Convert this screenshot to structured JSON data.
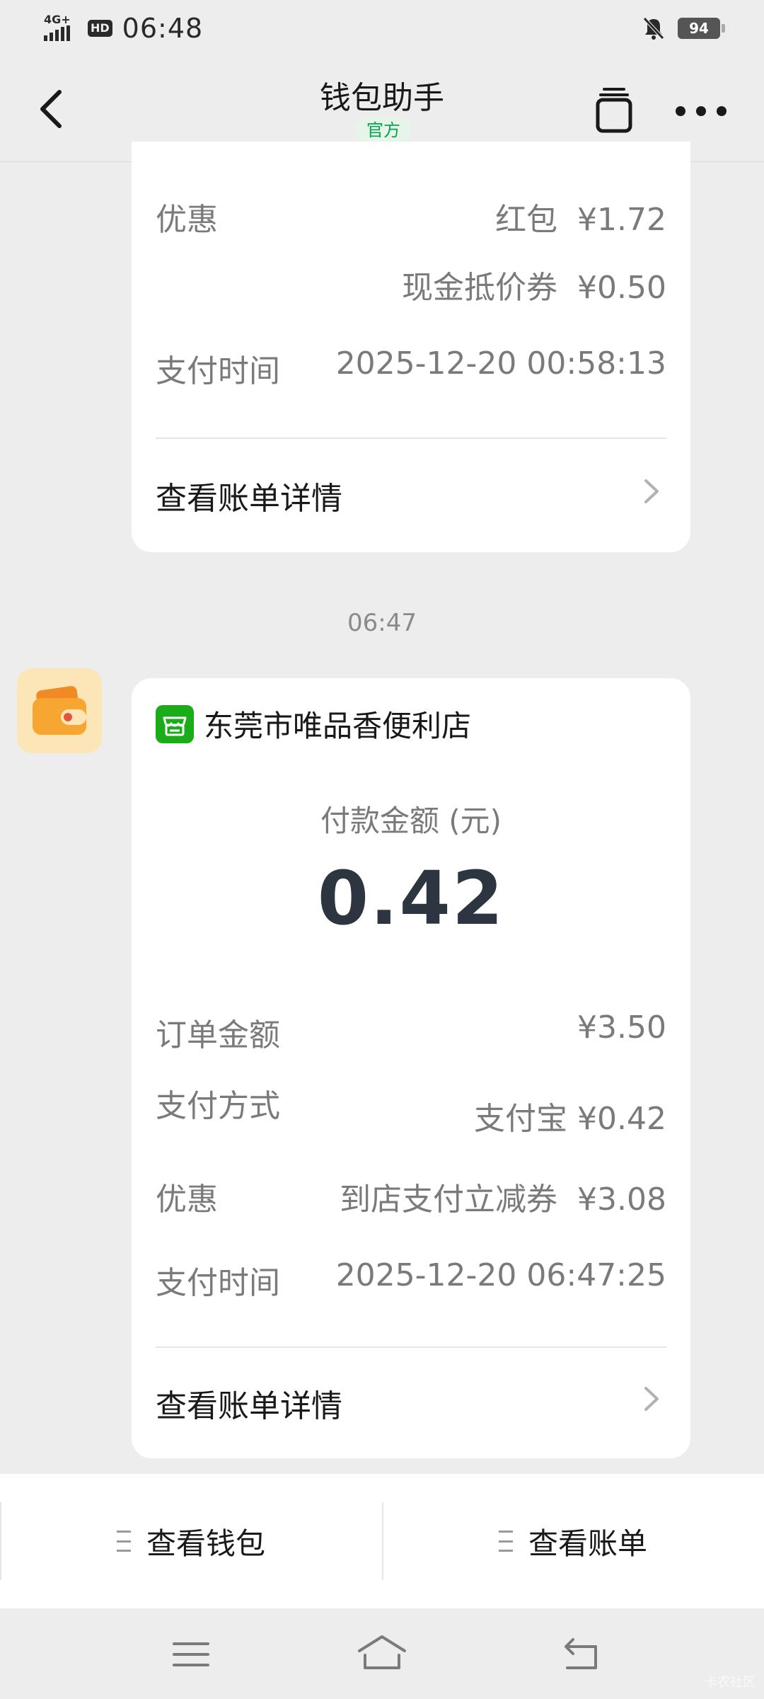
{
  "status_bar": {
    "network": "4G+",
    "hd": "HD",
    "time": "06:48",
    "battery": "94"
  },
  "nav": {
    "title": "钱包助手",
    "badge": "官方"
  },
  "card1": {
    "discount_label": "优惠",
    "discount_values": [
      "红包  ¥1.72",
      "现金抵价券  ¥0.50"
    ],
    "pay_time_label": "支付时间",
    "pay_time": "2025-12-20 00:58:13",
    "detail_link": "查看账单详情"
  },
  "time_separator": "06:47",
  "card2": {
    "merchant": "东莞市唯品香便利店",
    "amount_label": "付款金额 (元)",
    "amount": "0.42",
    "rows": [
      {
        "label": "订单金额",
        "value": "¥3.50"
      },
      {
        "label": "支付方式",
        "value": "支付宝 ¥0.42"
      },
      {
        "label": "优惠",
        "value": "到店支付立减券  ¥3.08"
      },
      {
        "label": "支付时间",
        "value": "2025-12-20 06:47:25"
      }
    ],
    "detail_link": "查看账单详情"
  },
  "menu": {
    "wallet": "查看钱包",
    "bills": "查看账单"
  },
  "watermark": "卡农社区",
  "colors": {
    "background": "#EDEDED",
    "card": "#FFFFFF",
    "accent_green": "#07A34E",
    "amount_text": "#2C3540",
    "wallet_orange": "#F5A623"
  }
}
